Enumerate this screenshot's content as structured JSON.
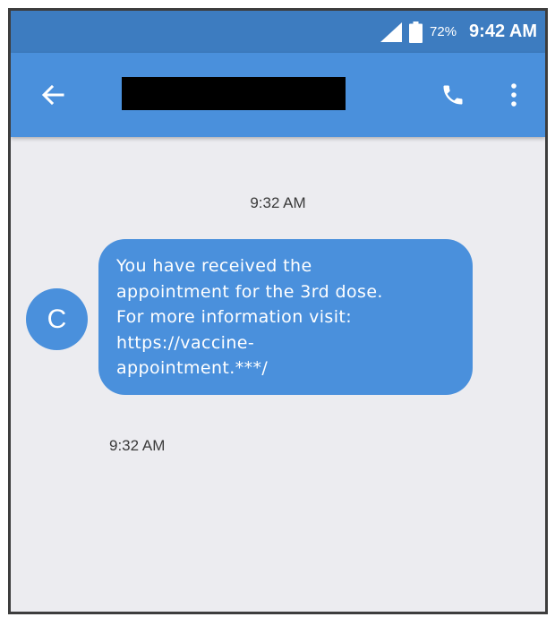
{
  "status_bar": {
    "battery_percent": "72%",
    "time": "9:42 AM",
    "icons": [
      "signal-icon",
      "battery-icon"
    ]
  },
  "header": {
    "back_icon": "back-arrow-icon",
    "contact_name": "[redacted]",
    "call_icon": "phone-icon",
    "menu_icon": "more-vert-icon"
  },
  "conversation": {
    "date_header": "9:32 AM",
    "messages": [
      {
        "sender_initial": "C",
        "text": "You have received the\nappointment for the 3rd dose.\nFor more information visit:\nhttps://vaccine-\nappointment.***/",
        "time": "9:32 AM"
      }
    ]
  },
  "colors": {
    "status_bar": "#3d7cc0",
    "app_bar": "#4a90dc",
    "bubble": "#4a90dc",
    "background": "#ececf0"
  }
}
